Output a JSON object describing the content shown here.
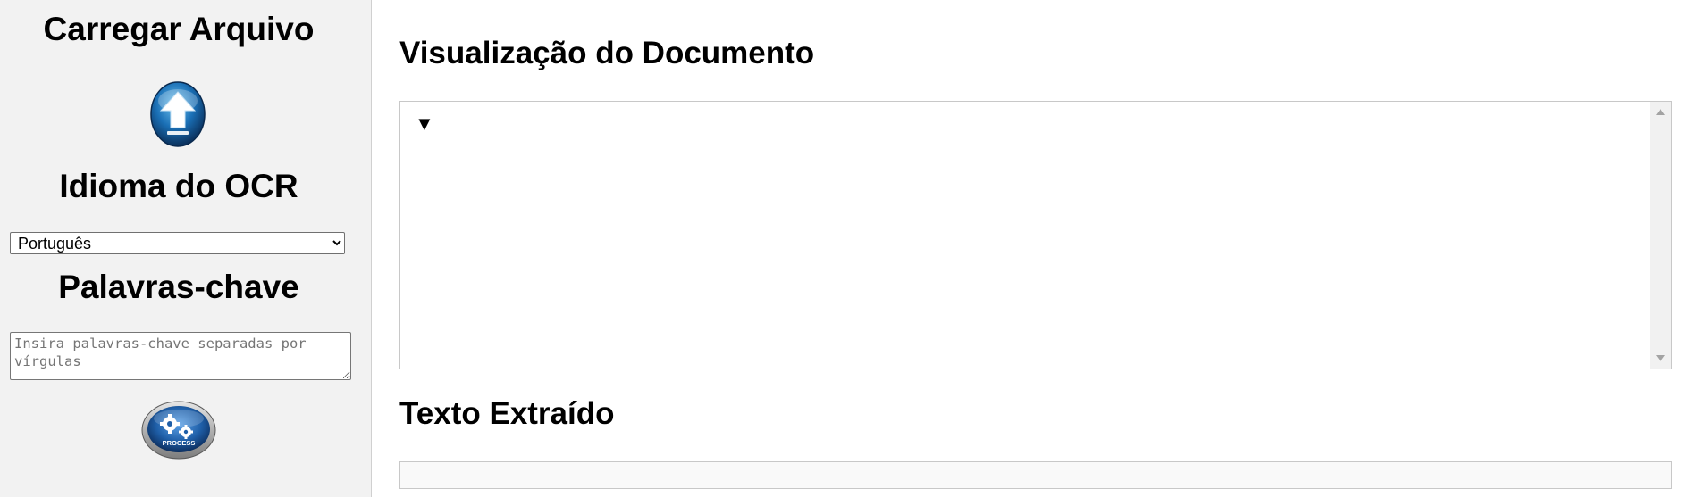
{
  "sidebar": {
    "upload_title": "Carregar Arquivo",
    "upload_icon": "upload-arrow-icon",
    "language_title": "Idioma do OCR",
    "language_selected": "Português",
    "keywords_title": "Palavras-chave",
    "keywords_placeholder": "Insira palavras-chave separadas por vírgulas",
    "process_label": "PROCESS",
    "process_icon": "gears-icon"
  },
  "main": {
    "preview_title": "Visualização do Documento",
    "preview_toggle": "▼",
    "text_title": "Texto Extraído"
  },
  "colors": {
    "sidebar_bg": "#f2f2f2",
    "upload_blue": "#1a6fb5",
    "process_blue": "#1f5fa8"
  }
}
